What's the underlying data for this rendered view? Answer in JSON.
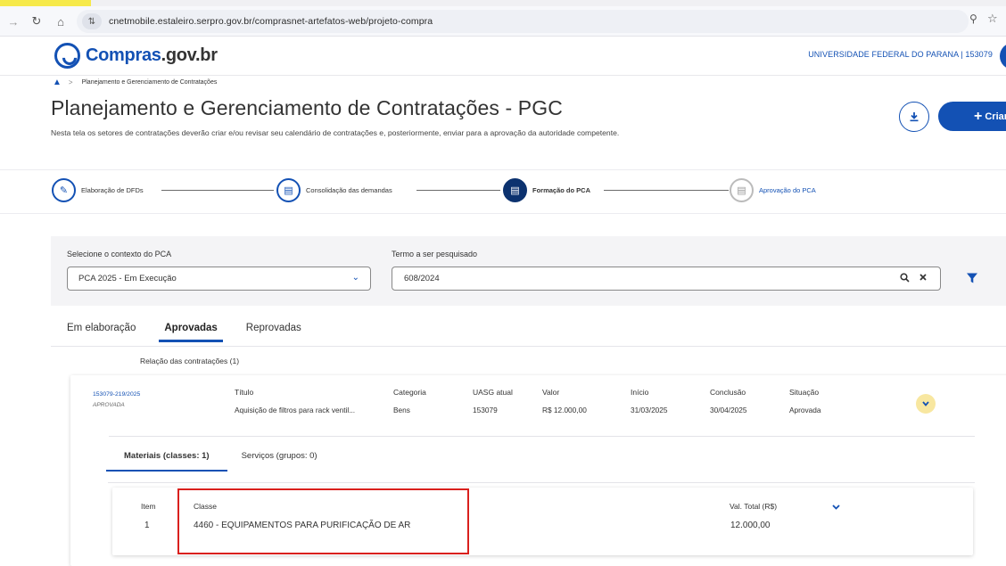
{
  "browser": {
    "url": "cnetmobile.estaleiro.serpro.gov.br/comprasnet-artefatos-web/projeto-compra"
  },
  "header": {
    "logo_text_main": "Compras",
    "logo_text_dot": ".gov.br",
    "org_name": "UNIVERSIDADE FEDERAL DO PARANA | 153079",
    "brand_color": "#1351b4"
  },
  "breadcrumb": {
    "current": "Planejamento e Gerenciamento de Contratações"
  },
  "page": {
    "title": "Planejamento e Gerenciamento de Contratações - PGC",
    "description": "Nesta tela os setores de contratações deverão criar e/ou revisar seu calendário de contratações e, posteriormente, enviar para a aprovação da autoridade competente.",
    "create_label": "Criar"
  },
  "stepper": {
    "steps": [
      {
        "label": "Elaboração de DFDs",
        "state": "done"
      },
      {
        "label": "Consolidação das demandas",
        "state": "done"
      },
      {
        "label": "Formação do PCA",
        "state": "active"
      },
      {
        "label": "Aprovação do PCA",
        "state": "pending"
      }
    ]
  },
  "filters": {
    "context_label": "Selecione o contexto do PCA",
    "context_value": "PCA 2025 - Em Execução",
    "search_label": "Termo a ser pesquisado",
    "search_value": "608/2024"
  },
  "tabs": [
    {
      "label": "Em elaboração",
      "active": false
    },
    {
      "label": "Aprovadas",
      "active": true
    },
    {
      "label": "Reprovadas",
      "active": false
    }
  ],
  "relacao": "Relação das contratações (1)",
  "contratacao": {
    "id": "153079-219/2025",
    "status_sub": "APROVADA",
    "headers": {
      "titulo": "Título",
      "categoria": "Categoria",
      "uasg": "UASG atual",
      "valor": "Valor",
      "inicio": "Início",
      "conclusao": "Conclusão",
      "situacao": "Situação"
    },
    "values": {
      "titulo": "Aquisição de filtros para rack ventil...",
      "categoria": "Bens",
      "uasg": "153079",
      "valor": "R$ 12.000,00",
      "inicio": "31/03/2025",
      "conclusao": "30/04/2025",
      "situacao": "Aprovada"
    }
  },
  "subtabs": [
    {
      "label": "Materiais (classes: 1)",
      "active": true
    },
    {
      "label": "Serviços (grupos: 0)",
      "active": false
    }
  ],
  "itens": {
    "headers": {
      "item": "Item",
      "classe": "Classe",
      "val_total": "Val. Total (R$)"
    },
    "rows": [
      {
        "item": "1",
        "classe": "4460 - EQUIPAMENTOS PARA PURIFICAÇÃO DE AR",
        "val_total": "12.000,00"
      }
    ]
  }
}
